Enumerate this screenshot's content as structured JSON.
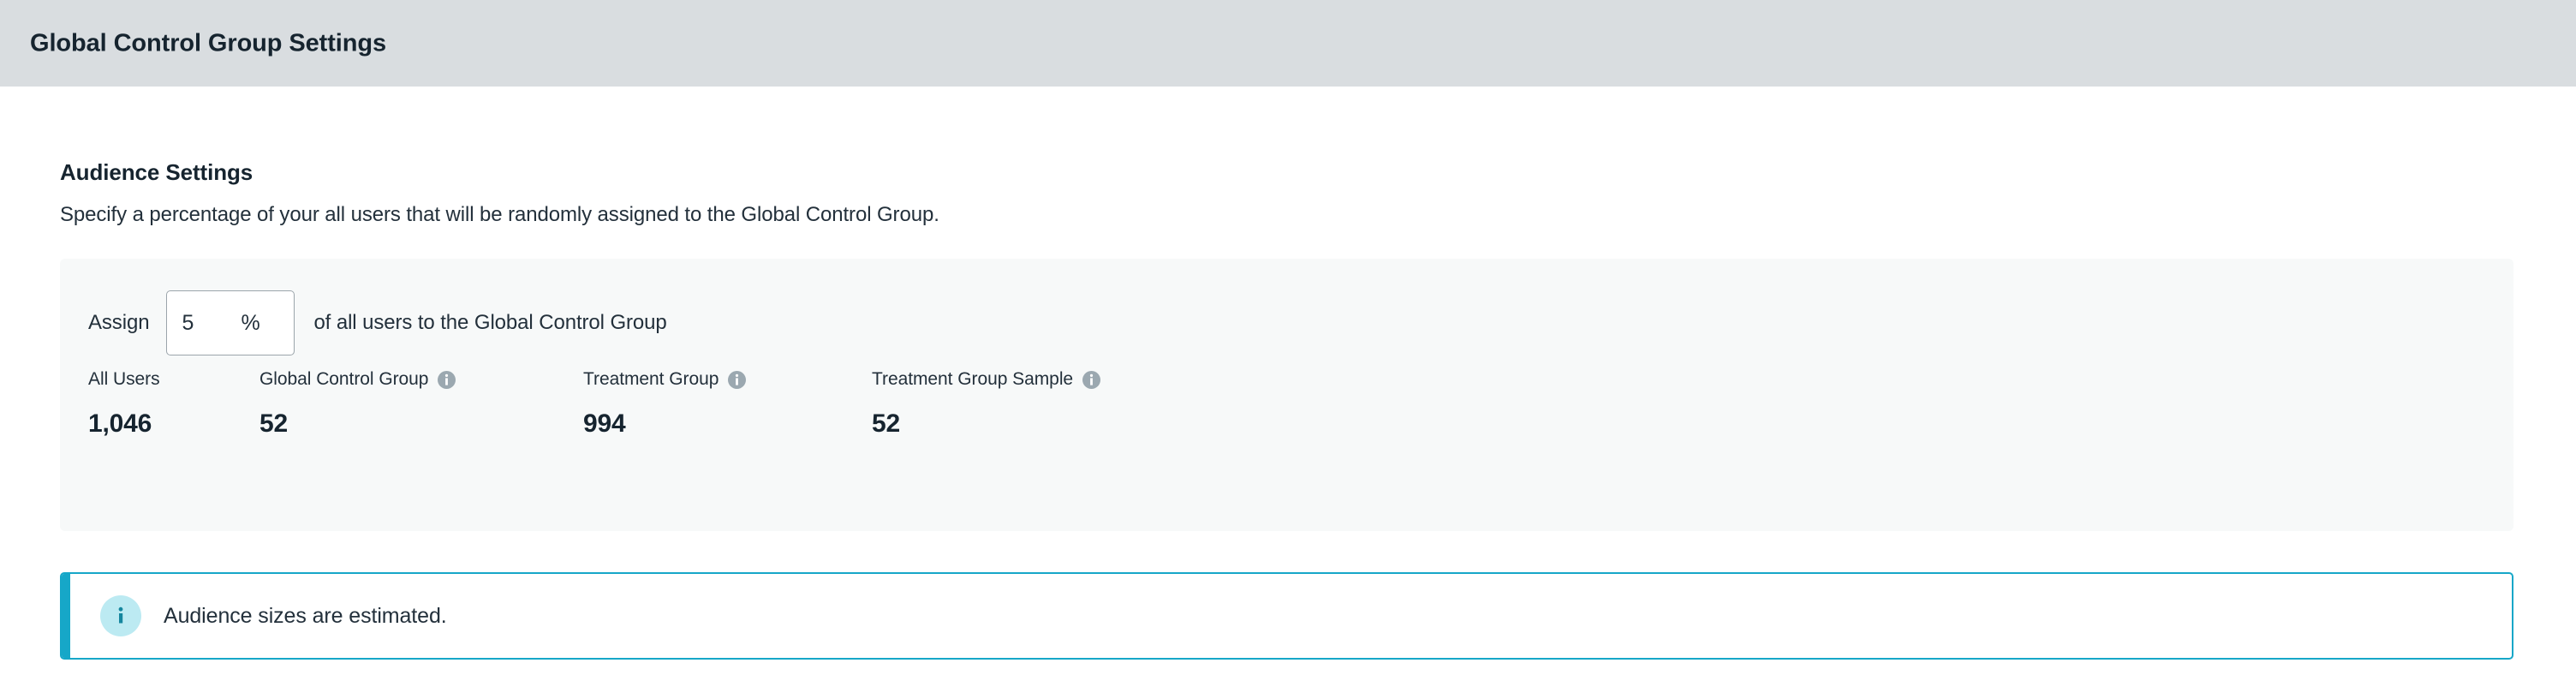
{
  "header": {
    "title": "Global Control Group Settings",
    "background_color": "#d9dde0"
  },
  "section": {
    "heading": "Audience Settings",
    "description": "Specify a percentage of your all users that will be randomly assigned to the Global Control Group."
  },
  "assign_row": {
    "prefix_label": "Assign",
    "percent_value": "5",
    "percent_suffix": "%",
    "suffix_label": "of all users to the Global Control Group"
  },
  "stats": [
    {
      "label": "All Users",
      "value": "1,046",
      "has_info_icon": false,
      "icon": ""
    },
    {
      "label": "Global Control Group",
      "value": "52",
      "has_info_icon": true,
      "icon": "info-icon"
    },
    {
      "label": "Treatment Group",
      "value": "994",
      "has_info_icon": true,
      "icon": "info-icon"
    },
    {
      "label": "Treatment Group Sample",
      "value": "52",
      "has_info_icon": true,
      "icon": "info-icon"
    }
  ],
  "info_banner": {
    "icon": "info-icon",
    "message": "Audience sizes are estimated.",
    "accent_color": "#16a7c8",
    "badge_color": "#bceaf2"
  },
  "colors": {
    "panel_background": "#f7f9f9",
    "text_primary": "#16242f",
    "text_body": "#23303b",
    "info_icon_gray": "#9ba8b0",
    "teal_accent": "#16a7c8"
  }
}
